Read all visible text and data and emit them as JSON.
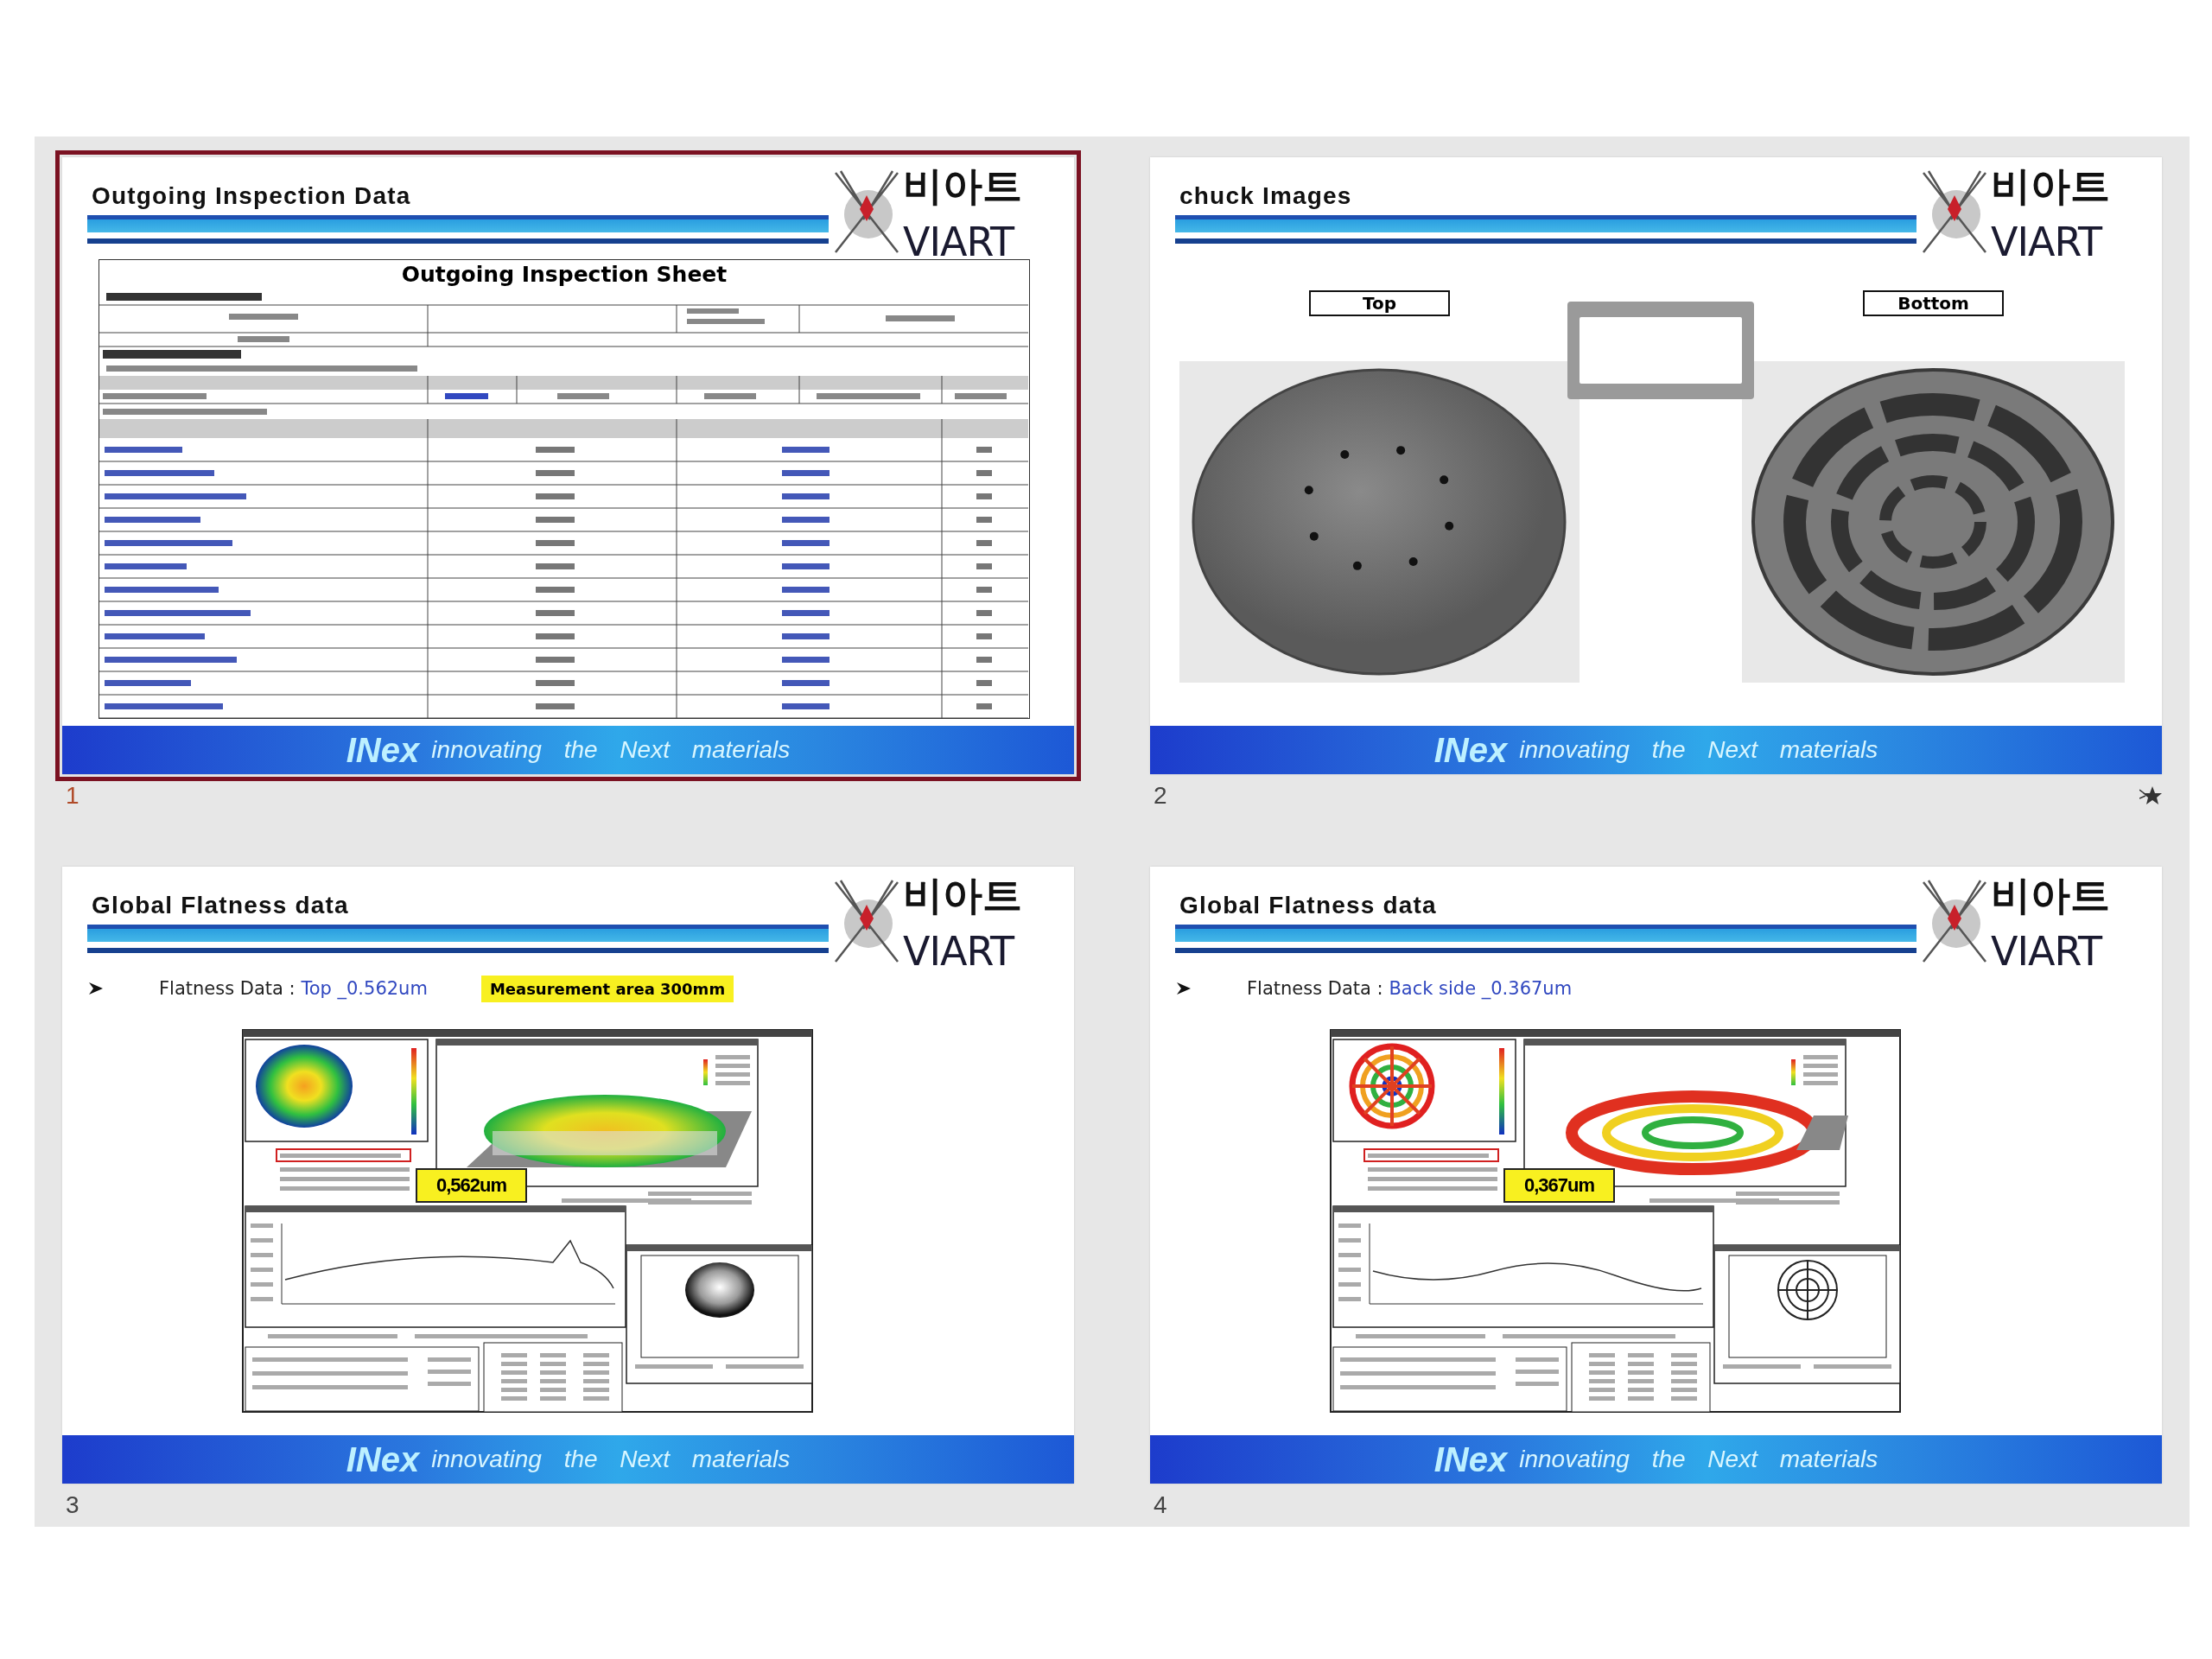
{
  "slides": [
    {
      "number": "1",
      "selected": true,
      "transition": false,
      "kind": "inspection-sheet",
      "title": "Outgoing Inspection Data",
      "logo": {
        "korean": "비아트",
        "latin": "VIART"
      },
      "sheet_title": "Outgoing Inspection Sheet",
      "footer": {
        "brand": "INex",
        "tagline": "innovating the Next materials"
      }
    },
    {
      "number": "2",
      "selected": false,
      "transition": true,
      "kind": "chuck-images",
      "title": "chuck Images",
      "logo": {
        "korean": "비아트",
        "latin": "VIART"
      },
      "labels": [
        "Top",
        "Bottom"
      ],
      "footer": {
        "brand": "INex",
        "tagline": "innovating the Next materials"
      }
    },
    {
      "number": "3",
      "selected": false,
      "transition": false,
      "kind": "flatness",
      "title": "Global Flatness data",
      "logo": {
        "korean": "비아트",
        "latin": "VIART"
      },
      "bullet_label": "Flatness Data : ",
      "bullet_value": "Top _0.562um",
      "highlight": "Measurement area 300mm",
      "measurement": {
        "kind": "solid",
        "reading": "0,562um"
      },
      "footer": {
        "brand": "INex",
        "tagline": "innovating the Next materials"
      }
    },
    {
      "number": "4",
      "selected": false,
      "transition": false,
      "kind": "flatness",
      "title": "Global Flatness data",
      "logo": {
        "korean": "비아트",
        "latin": "VIART"
      },
      "bullet_label": "Flatness Data : ",
      "bullet_value": "Back side _0.367um",
      "measurement": {
        "kind": "ribbed",
        "reading": "0,367um"
      },
      "footer": {
        "brand": "INex",
        "tagline": "innovating the Next materials"
      }
    }
  ]
}
